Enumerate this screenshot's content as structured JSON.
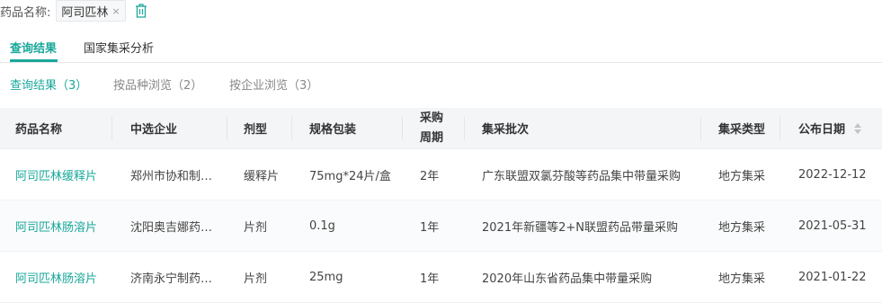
{
  "filter": {
    "label": "药品名称:",
    "tag_value": "阿司匹林",
    "tag_close": "×"
  },
  "main_tabs": [
    {
      "label": "查询结果",
      "active": true
    },
    {
      "label": "国家集采分析",
      "active": false
    }
  ],
  "sub_tabs": [
    {
      "label": "查询结果（3）",
      "active": true
    },
    {
      "label": "按品种浏览（2）",
      "active": false
    },
    {
      "label": "按企业浏览（3）",
      "active": false
    }
  ],
  "table": {
    "headers": [
      "药品名称",
      "中选企业",
      "剂型",
      "规格包装",
      "采购周期",
      "集采批次",
      "集采类型",
      "公布日期"
    ],
    "header_purchase_cycle_line1": "采购",
    "header_purchase_cycle_line2": "周期",
    "rows": [
      [
        "阿司匹林缓释片",
        "郑州市协和制…",
        "缓释片",
        "75mg*24片/盒",
        "2年",
        "广东联盟双氯芬酸等药品集中带量采购",
        "地方集采",
        "2022-12-12"
      ],
      [
        "阿司匹林肠溶片",
        "沈阳奥吉娜药…",
        "片剂",
        "0.1g",
        "1年",
        "2021年新疆等2+N联盟药品带量采购",
        "地方集采",
        "2021-05-31"
      ],
      [
        "阿司匹林肠溶片",
        "济南永宁制药…",
        "片剂",
        "25mg",
        "1年",
        "2020年山东省药品集中带量采购",
        "地方集采",
        "2021-01-22"
      ]
    ]
  },
  "colors": {
    "accent": "#1aa89b",
    "header_bg": "#f3f5f7"
  },
  "icons": {
    "delete": "trash-icon",
    "sort": "sort-icon",
    "close": "close-icon"
  }
}
